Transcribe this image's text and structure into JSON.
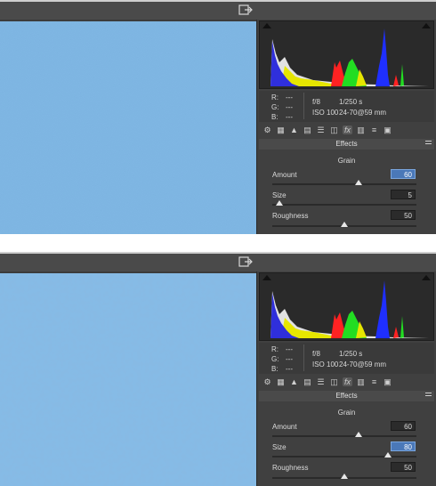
{
  "panels": [
    {
      "canvas_grain": "fine",
      "info": {
        "rgb": [
          {
            "label": "R:",
            "value": "---"
          },
          {
            "label": "G:",
            "value": "---"
          },
          {
            "label": "B:",
            "value": "---"
          }
        ],
        "aperture": "f/8",
        "shutter": "1/250 s",
        "iso": "ISO 100",
        "lens": "24-70@59 mm"
      },
      "section_title": "Effects",
      "group_title": "Grain",
      "sliders": [
        {
          "label": "Amount",
          "value": "60",
          "level": 0.6,
          "focused": true
        },
        {
          "label": "Size",
          "value": "5",
          "level": 0.05,
          "focused": false
        },
        {
          "label": "Roughness",
          "value": "50",
          "level": 0.5,
          "focused": false
        }
      ]
    },
    {
      "canvas_grain": "coarse",
      "info": {
        "rgb": [
          {
            "label": "R:",
            "value": "---"
          },
          {
            "label": "G:",
            "value": "---"
          },
          {
            "label": "B:",
            "value": "---"
          }
        ],
        "aperture": "f/8",
        "shutter": "1/250 s",
        "iso": "ISO 100",
        "lens": "24-70@59 mm"
      },
      "section_title": "Effects",
      "group_title": "Grain",
      "sliders": [
        {
          "label": "Amount",
          "value": "60",
          "level": 0.6,
          "focused": false
        },
        {
          "label": "Size",
          "value": "80",
          "level": 0.8,
          "focused": true
        },
        {
          "label": "Roughness",
          "value": "50",
          "level": 0.5,
          "focused": false
        }
      ]
    }
  ],
  "tool_icons": [
    "aperture-icon",
    "grid-icon",
    "mountain-icon",
    "split-icon",
    "stripes-icon",
    "lens-icon",
    "fx-icon",
    "camera-film-icon",
    "sliders-icon",
    "presets-icon"
  ],
  "colors": {
    "canvas_blue": "#78b0e0",
    "panel_bg": "#3c3c3c",
    "focus_blue": "#4a78b8"
  }
}
